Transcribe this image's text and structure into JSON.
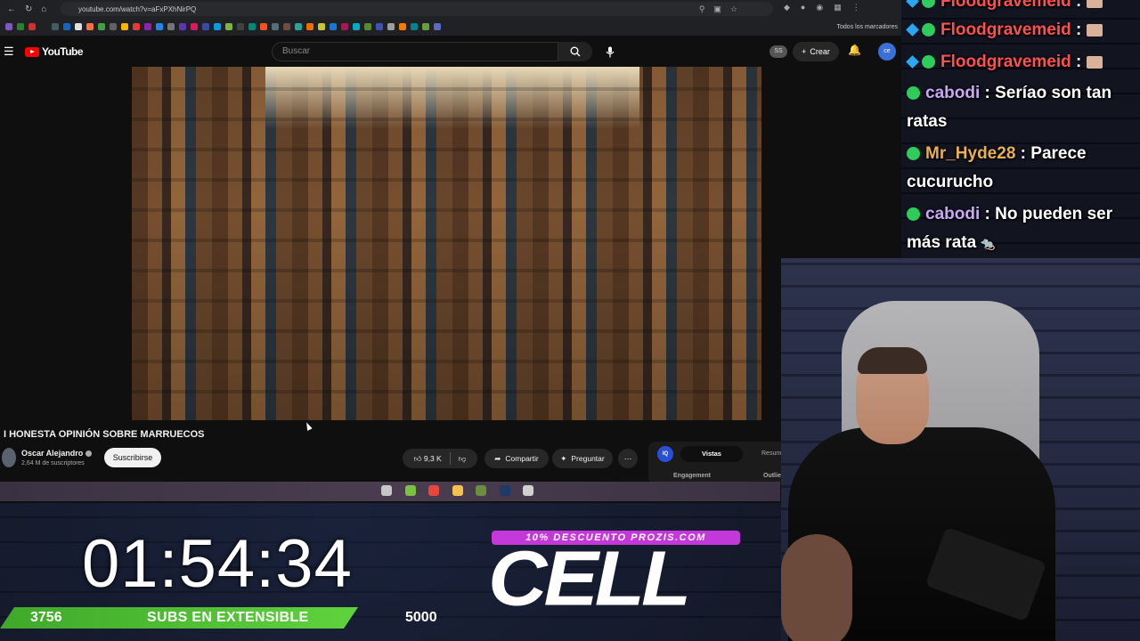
{
  "browser": {
    "url": "youtube.com/watch?v=aFxPXhNirPQ",
    "bookmarks_folder": "Todos los marcadores",
    "bookmark_colors": [
      "#7e57c2",
      "#2e7d32",
      "#d32f2f",
      "#212121",
      "#455a64",
      "#1565c0",
      "#e0e0e0",
      "#ff7043",
      "#43a047",
      "#616161",
      "#ffb300",
      "#e53935",
      "#8e24aa",
      "#1e88e5",
      "#757575",
      "#5e35b1",
      "#d81b60",
      "#3949ab",
      "#039be5",
      "#7cb342",
      "#424242",
      "#00897b",
      "#f4511e",
      "#546e7a",
      "#6d4c41",
      "#26a69a",
      "#ef6c00",
      "#c0ca33",
      "#1976d2",
      "#ad1457",
      "#00acc1",
      "#558b2f",
      "#3f51b5",
      "#9e9e9e",
      "#f57c00",
      "#00838f",
      "#689f38",
      "#5c6bc0"
    ]
  },
  "youtube": {
    "logo_text": "YouTube",
    "search_placeholder": "Buscar",
    "ss_badge": "SS",
    "create_label": "Crear",
    "avatar_text": "ce",
    "video_title": "I HONESTA OPINIÓN SOBRE MARRUECOS",
    "channel_name": "Oscar Alejandro",
    "subscriber_count": "2,64 M de suscriptores",
    "subscribe_label": "Suscribirse",
    "like_count": "9,3 K",
    "share_label": "Compartir",
    "ask_label": "Preguntar",
    "widget": {
      "badge": "IQ",
      "tab_active": "Vistas",
      "tab_other": "Resum",
      "label_left": "Engagement",
      "label_right": "Outlie"
    }
  },
  "taskbar_icons": [
    {
      "name": "steam-icon",
      "color": "#c7c7c7"
    },
    {
      "name": "xbox-icon",
      "color": "#7cc242"
    },
    {
      "name": "chrome-icon",
      "color": "#e8453c"
    },
    {
      "name": "folder-icon",
      "color": "#f2c14e"
    },
    {
      "name": "minecraft-icon",
      "color": "#6b8e3e"
    },
    {
      "name": "photoshop-icon",
      "color": "#1f3a68"
    },
    {
      "name": "app-icon",
      "color": "#d0d0d0"
    }
  ],
  "chat": [
    {
      "user": "Floodgravemeid",
      "sep": " :",
      "msg": "",
      "type": "flood"
    },
    {
      "user": "Floodgravemeid",
      "sep": " :",
      "msg": "",
      "type": "flood"
    },
    {
      "user": "Floodgravemeid",
      "sep": " :",
      "msg": "",
      "type": "flood"
    },
    {
      "user": "cabodi",
      "sep": " :",
      "msg": " Seríao son tan",
      "msg2": "ratas",
      "type": "cabodi"
    },
    {
      "user": "Mr_Hyde28",
      "sep": " :",
      "msg": " Parece",
      "msg2": "cucurucho",
      "type": "hyde"
    },
    {
      "user": "cabodi",
      "sep": " :",
      "msg": " No pueden ser",
      "msg2": "más rata",
      "type": "cabodi"
    }
  ],
  "overlay": {
    "timer": "01:54:34",
    "subs_current": "3756",
    "subs_label": "SUBS EN EXTENSIBLE",
    "subs_goal": "5000",
    "subs_progress": 0.7512,
    "promo_text": "10% DESCUENTO PROZIS.COM",
    "sponsor_logo": "CELL",
    "accent_green": "#4cc236",
    "accent_purple": "#c338d9"
  }
}
